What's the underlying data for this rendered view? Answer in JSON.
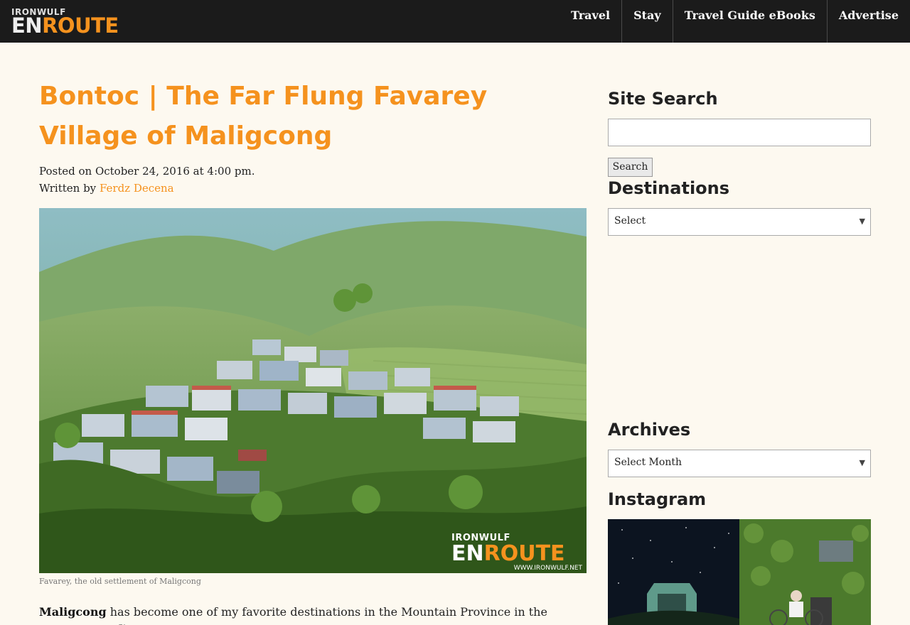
{
  "header": {
    "logo": {
      "top": "IRONWULF",
      "main_en": "EN",
      "main_route": "ROUTE"
    },
    "nav": [
      "Travel",
      "Stay",
      "Travel Guide eBooks",
      "Advertise"
    ]
  },
  "article": {
    "title": "Bontoc | The Far Flung Favarey Village of Maligcong",
    "posted": "Posted on October 24, 2016 at 4:00 pm.",
    "written_by_label": "Written by",
    "author": "Ferdz Decena",
    "image_watermark": {
      "top": "IRONWULF",
      "main_en": "EN",
      "main_route": "ROUTE",
      "url": "WWW.IRONWULF.NET"
    },
    "caption": "Favarey, the old settlement of Maligcong",
    "intro_bold": "Maligcong",
    "intro_text": " has become one of my favorite destinations in the Mountain Province in the recent years. I've"
  },
  "sidebar": {
    "search_heading": "Site Search",
    "search_button": "Search",
    "destinations_heading": "Destinations",
    "destinations_value": "Select",
    "archives_heading": "Archives",
    "archives_value": "Select Month",
    "instagram_heading": "Instagram"
  },
  "colors": {
    "accent": "#f5921e",
    "topbar": "#1b1b1b",
    "background": "#fdf9f0"
  }
}
